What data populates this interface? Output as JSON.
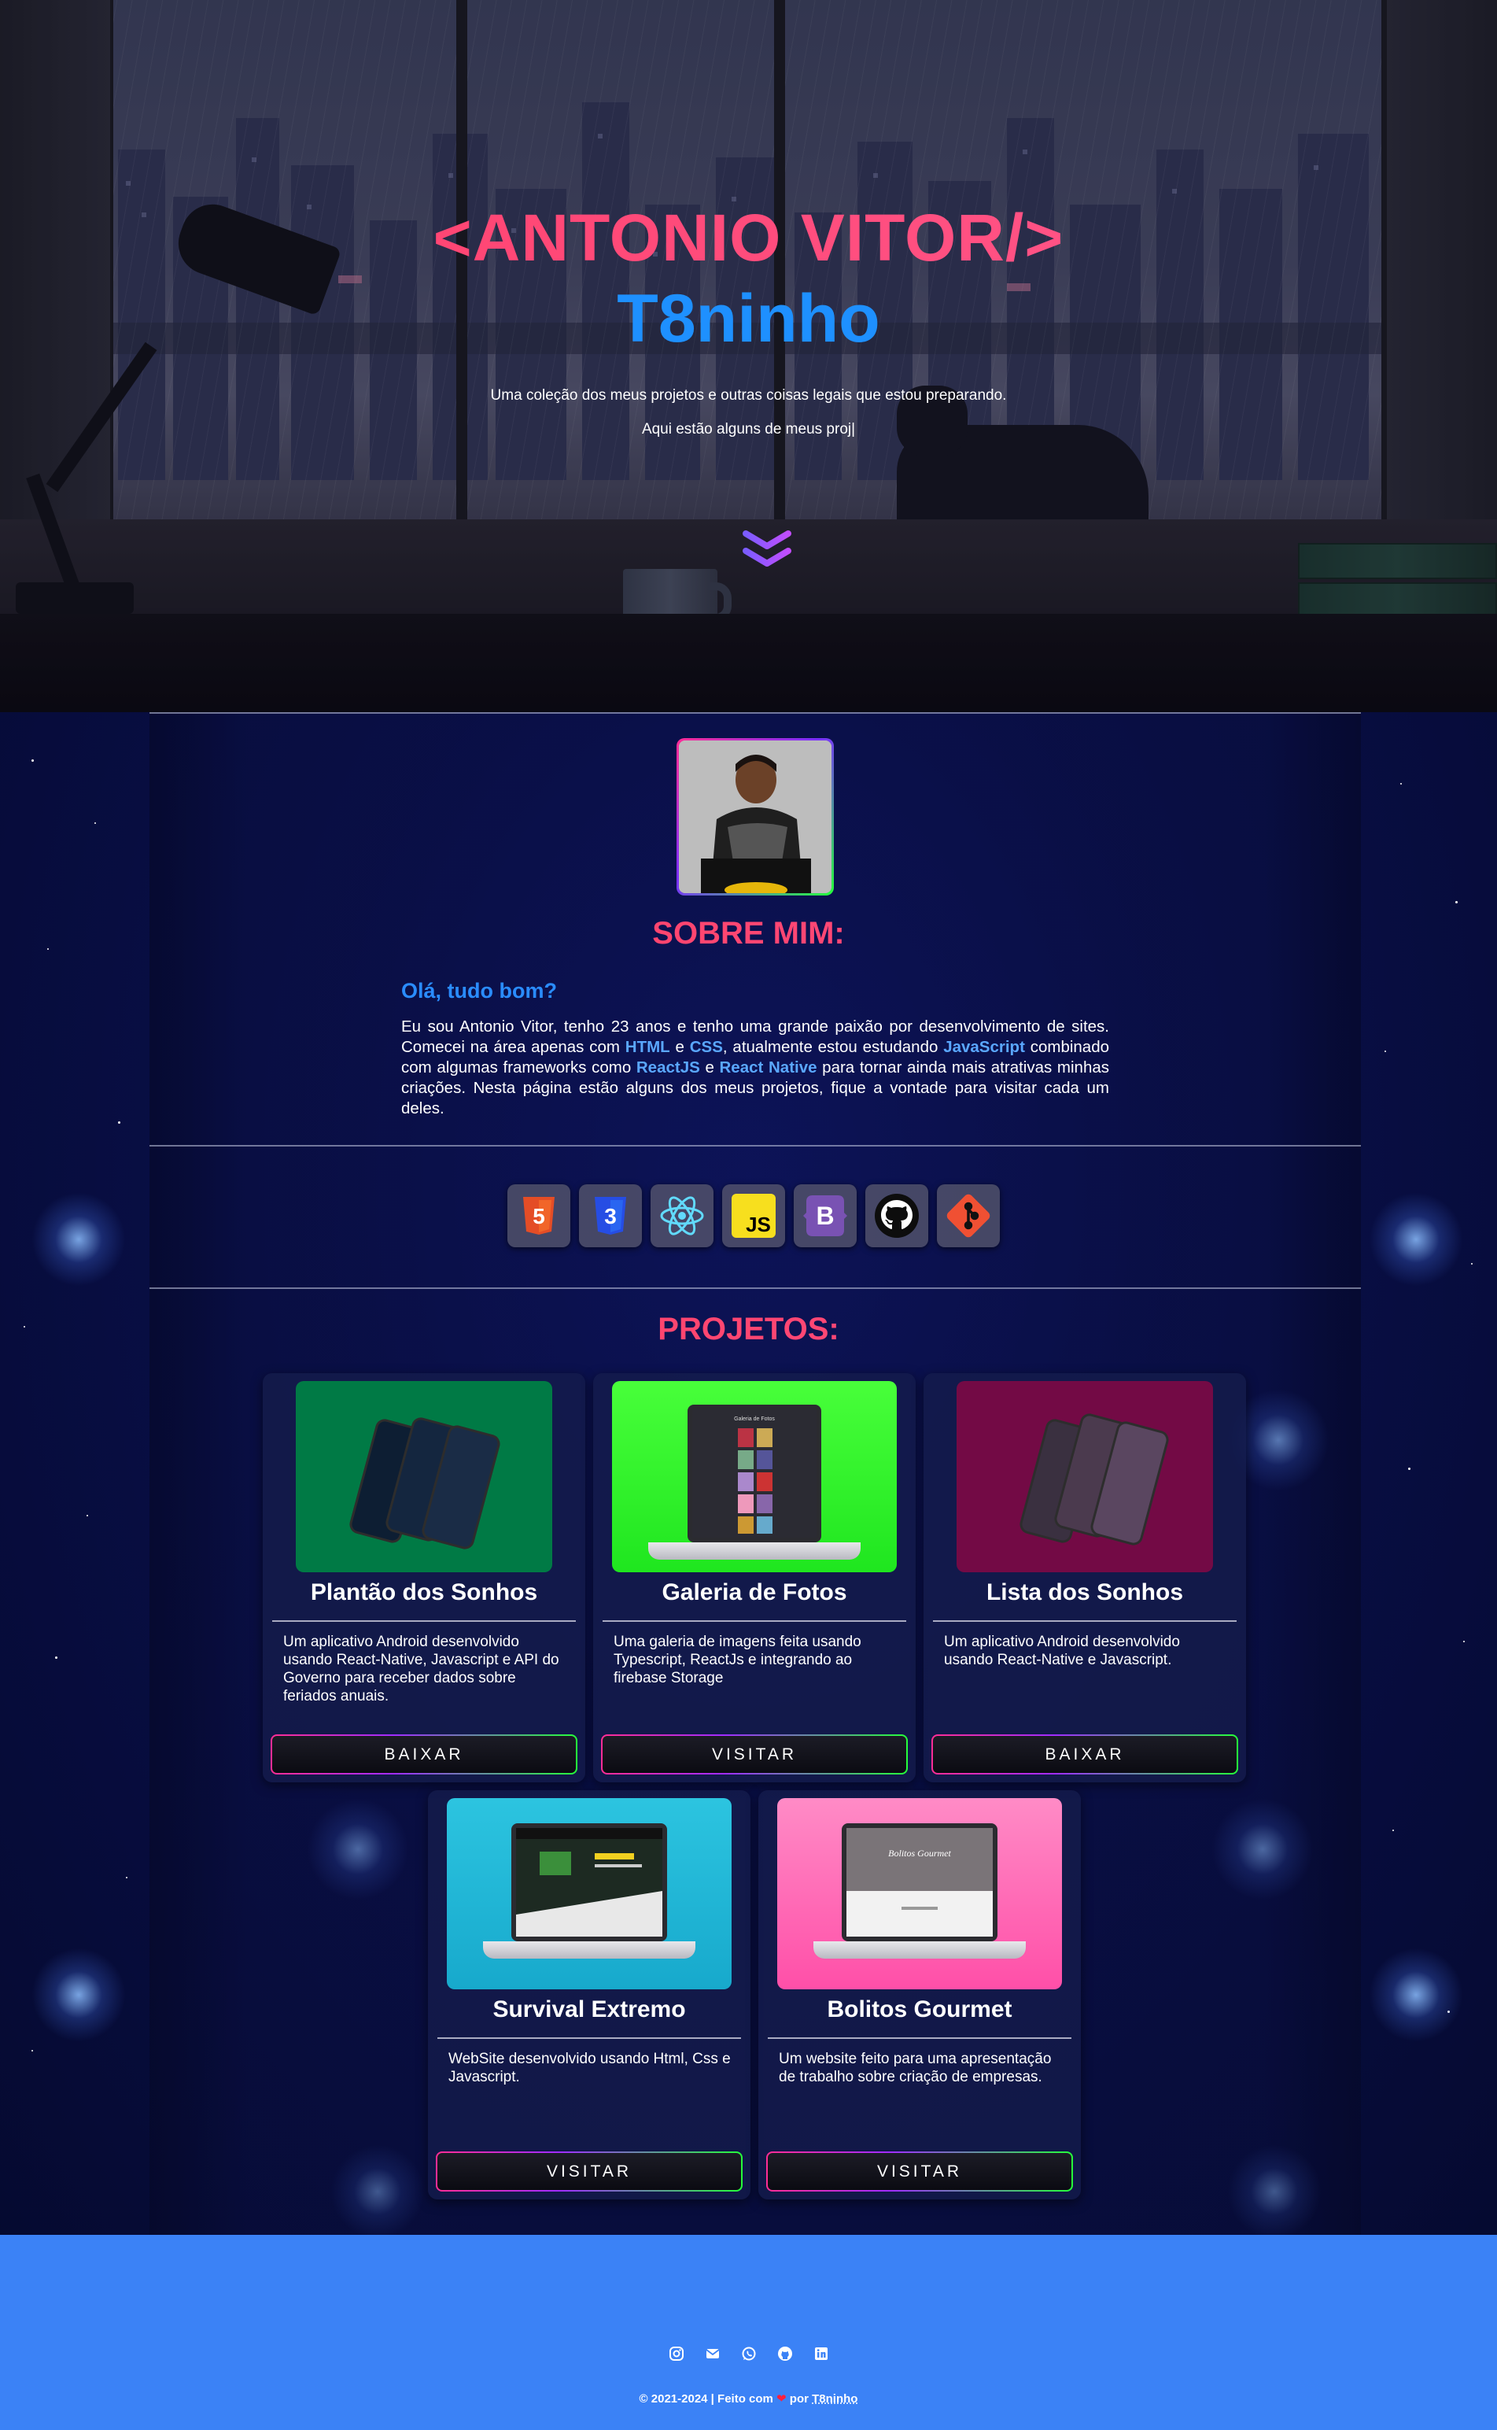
{
  "hero": {
    "title": "<ANTONIO VITOR/>",
    "subtitle": "T8ninho",
    "description": "Uma coleção dos meus projetos e outras coisas legais que estou preparando.",
    "typed_text": "Aqui estão alguns de meus proj|",
    "scroll_icon": "double-chevron-down-icon"
  },
  "about": {
    "avatar_alt": "Antonio Vitor",
    "section_title": "SOBRE MIM:",
    "greeting": "Olá, tudo bom?",
    "p1": "Eu sou Antonio Vitor, tenho 23 anos e tenho uma grande paixão por desenvolvimento de sites. Comecei na área apenas com ",
    "html": "HTML",
    "and1": " e ",
    "css": "CSS",
    "p2": ", atualmente estou estudando ",
    "js": "JavaScript",
    "p3": " combinado com algumas frameworks como ",
    "reactjs": "ReactJS",
    "and2": " e ",
    "reactnative": "React Native",
    "p4": " para tornar ainda mais atrativas minhas criações. Nesta página estão alguns dos meus projetos, fique a vontade para visitar cada um deles."
  },
  "skills": [
    {
      "name": "html5-icon",
      "label": "5",
      "color": "#e44d26"
    },
    {
      "name": "css3-icon",
      "label": "3",
      "color": "#264de4"
    },
    {
      "name": "react-icon",
      "label": "",
      "color": "#61dafb"
    },
    {
      "name": "javascript-icon",
      "label": "JS",
      "color": "#f7df1e"
    },
    {
      "name": "bootstrap-icon",
      "label": "B",
      "color": "#7952b3"
    },
    {
      "name": "github-icon",
      "label": "",
      "color": "#111111"
    },
    {
      "name": "git-icon",
      "label": "",
      "color": "#f05033"
    }
  ],
  "projects": {
    "section_title": "PROJETOS:",
    "items": [
      {
        "title": "Plantão dos Sonhos",
        "description": "Um aplicativo Android desenvolvido usando React-Native, Javascript e API do Governo para receber dados sobre feriados anuais.",
        "button": "BAIXAR",
        "bg": "#007a45"
      },
      {
        "title": "Galeria de Fotos",
        "description": "Uma galeria de imagens feita usando Typescript, ReactJs e integrando ao firebase Storage",
        "button": "VISITAR",
        "bg": "#2cf22c"
      },
      {
        "title": "Lista dos Sonhos",
        "description": "Um aplicativo Android desenvolvido usando React-Native e Javascript.",
        "button": "BAIXAR",
        "bg": "#730a45"
      },
      {
        "title": "Survival Extremo",
        "description": "WebSite desenvolvido usando Html, Css e Javascript.",
        "button": "VISITAR",
        "bg": "#22b6d6"
      },
      {
        "title": "Bolitos Gourmet",
        "description": "Um website feito para uma apresentação de trabalho sobre criação de empresas.",
        "button": "VISITAR",
        "bg": "#ff6fb6"
      }
    ],
    "galeria_screen_title": "Galeria de Fotos",
    "bolitos_screen_title": "Bolitos Gourmet"
  },
  "footer": {
    "social": [
      "instagram-icon",
      "email-icon",
      "whatsapp-icon",
      "github-icon",
      "linkedin-icon"
    ],
    "credit_prefix": "© 2021-2024 | Feito com ",
    "heart": "❤",
    "credit_by": " por ",
    "author": "T8ninho"
  },
  "colors": {
    "accent_pink": "#ff4f7c",
    "accent_blue": "#1e90ff",
    "footer_blue": "#3b82f6"
  }
}
